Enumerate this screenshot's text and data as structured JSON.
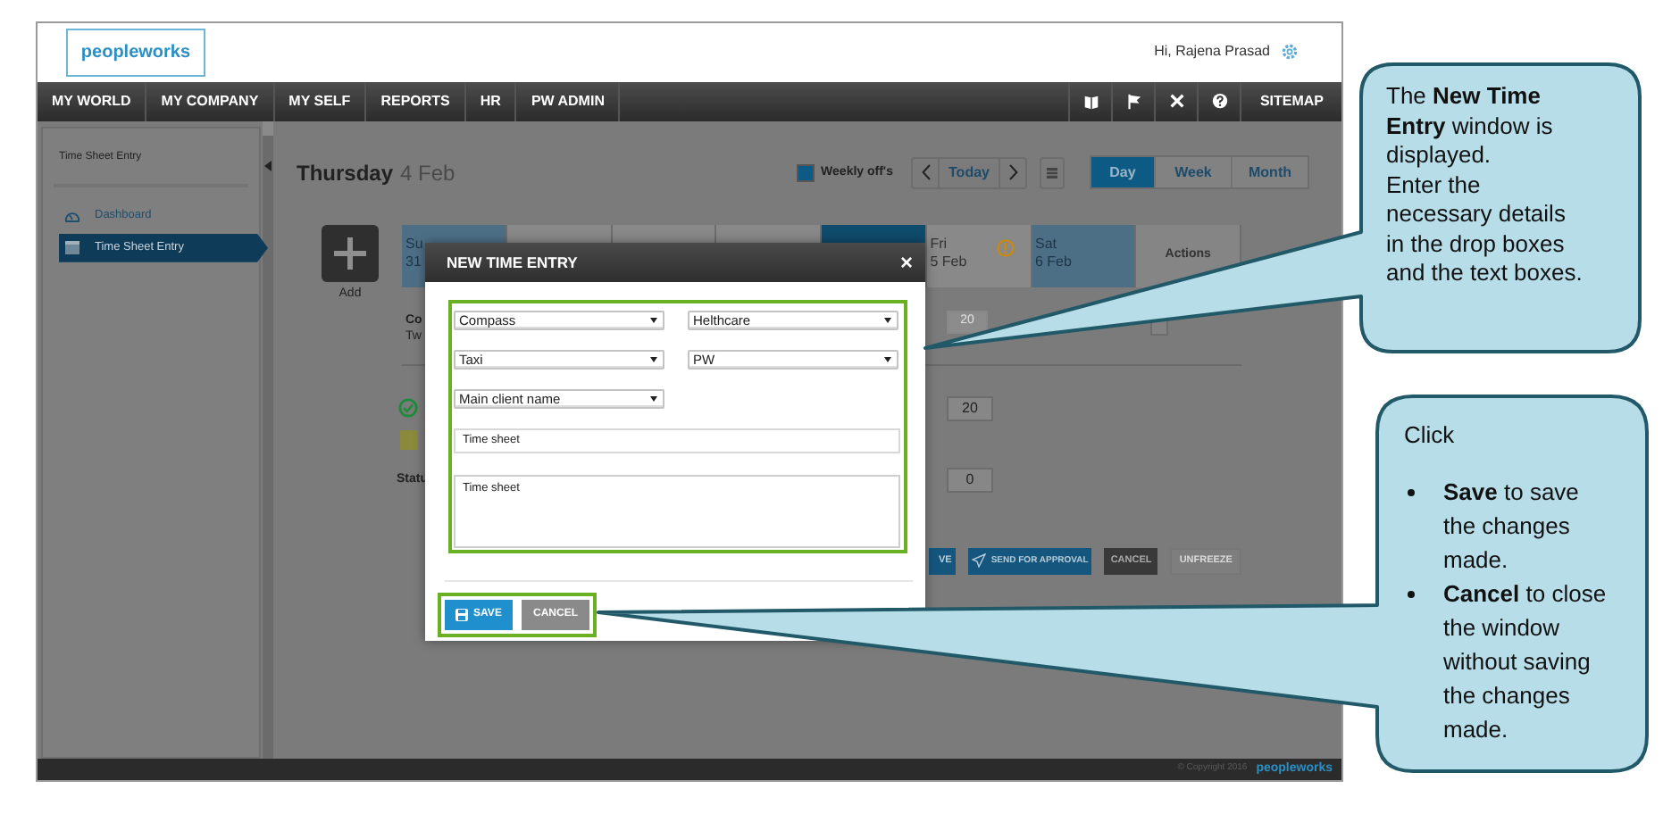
{
  "header": {
    "logo": "peopleworks",
    "greeting": "Hi, Rajena Prasad"
  },
  "nav": {
    "items": [
      "MY WORLD",
      "MY COMPANY",
      "MY SELF",
      "REPORTS",
      "HR",
      "PW ADMIN"
    ],
    "sitemap": "SITEMAP"
  },
  "sidebar": {
    "title": "Time Sheet Entry",
    "items": [
      {
        "label": "Dashboard",
        "selected": false
      },
      {
        "label": "Time Sheet Entry",
        "selected": true
      }
    ]
  },
  "toolbar": {
    "day": "Thursday",
    "date": "4 Feb",
    "legend": "Weekly off's",
    "today": "Today",
    "views": [
      {
        "label": "Day",
        "selected": true
      },
      {
        "label": "Week",
        "selected": false
      },
      {
        "label": "Month",
        "selected": false
      }
    ]
  },
  "add_label": "Add",
  "day_columns": [
    {
      "kind": "weekly_off",
      "line_1": "Su",
      "line_2": "31"
    },
    {
      "kind": "normal"
    },
    {
      "kind": "normal"
    },
    {
      "kind": "normal"
    },
    {
      "kind": "today"
    },
    {
      "kind": "normal",
      "line_1": "Fri",
      "line_2": "5 Feb",
      "warning": true
    },
    {
      "kind": "weekly_off",
      "line_1": "Sat",
      "line_2": "6 Feb"
    },
    {
      "kind": "actions",
      "line_1": "Actions"
    }
  ],
  "entry": {
    "line_1": "Co",
    "line_2": "Tw",
    "hours": "20"
  },
  "summary_rows": [
    {
      "kind": "check",
      "value": "20"
    },
    {
      "kind": "swatch"
    },
    {
      "kind": "label",
      "label": "Statu",
      "value": "0"
    }
  ],
  "actions": [
    {
      "label": "VE",
      "kind": "primary"
    },
    {
      "label": "SEND FOR APPROVAL",
      "kind": "send"
    },
    {
      "label": "CANCEL",
      "kind": "dark"
    },
    {
      "label": "UNFREEZE",
      "kind": "disabled"
    }
  ],
  "dialog": {
    "title": "NEW TIME ENTRY",
    "close": "×",
    "dropdowns": [
      "Compass",
      "Helthcare",
      "Taxi",
      "PW",
      "Main client name"
    ],
    "input": "Time sheet",
    "textarea": "Time sheet",
    "buttons": [
      {
        "label": "SAVE",
        "kind": "save"
      },
      {
        "label": "CANCEL",
        "kind": "cancel"
      }
    ]
  },
  "callouts": [
    {
      "paragraphs": [
        "The **New Time Entry** window is displayed.",
        "Enter the necessary details in the drop boxes and the text boxes."
      ]
    },
    {
      "intro": "Click",
      "bullets": [
        "**Save** to save the changes made.",
        "**Cancel** to close the window without saving the changes made."
      ]
    }
  ],
  "footer": {
    "copyright": "© Copyright 2016",
    "logo": "peopleworks"
  }
}
